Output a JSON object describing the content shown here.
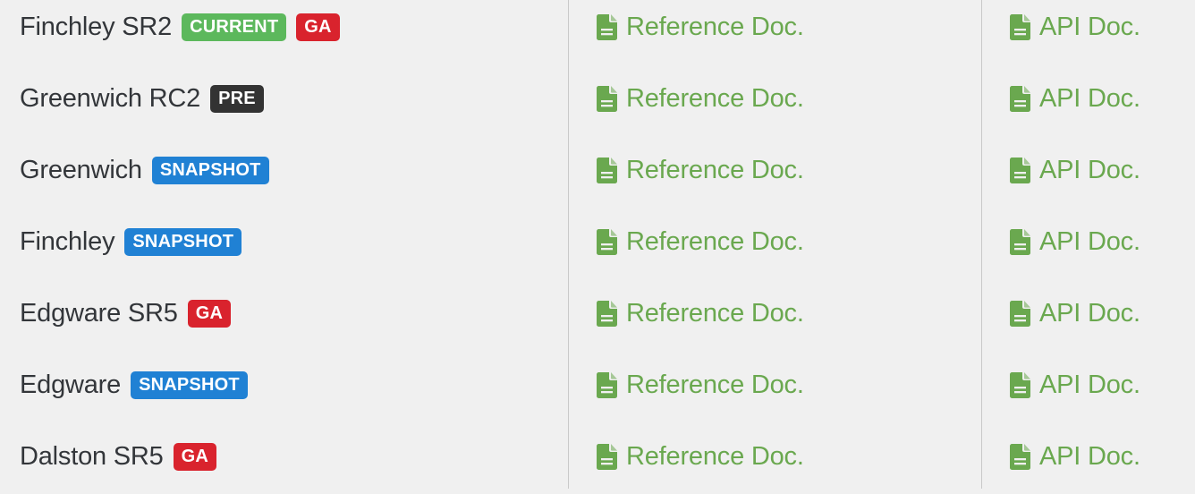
{
  "page": {
    "background_color": "#f0f0f0",
    "divider_color": "#c9c9c9"
  },
  "colors": {
    "version_text": "#33363a",
    "doc_link": "#6aa84f",
    "badge_current": "#5cb85c",
    "badge_ga": "#d9232d",
    "badge_pre": "#333333",
    "badge_snapshot": "#2081d4"
  },
  "icons": {
    "doc": "file-document-icon"
  },
  "rows": [
    {
      "version": "Finchley SR2",
      "badges": [
        {
          "label": "CURRENT",
          "type": "current"
        },
        {
          "label": "GA",
          "type": "ga"
        }
      ],
      "reference_doc": "Reference Doc.",
      "api_doc": "API Doc."
    },
    {
      "version": "Greenwich RC2",
      "badges": [
        {
          "label": "PRE",
          "type": "pre"
        }
      ],
      "reference_doc": "Reference Doc.",
      "api_doc": "API Doc."
    },
    {
      "version": "Greenwich",
      "badges": [
        {
          "label": "SNAPSHOT",
          "type": "snapshot"
        }
      ],
      "reference_doc": "Reference Doc.",
      "api_doc": "API Doc."
    },
    {
      "version": "Finchley",
      "badges": [
        {
          "label": "SNAPSHOT",
          "type": "snapshot"
        }
      ],
      "reference_doc": "Reference Doc.",
      "api_doc": "API Doc."
    },
    {
      "version": "Edgware SR5",
      "badges": [
        {
          "label": "GA",
          "type": "ga"
        }
      ],
      "reference_doc": "Reference Doc.",
      "api_doc": "API Doc."
    },
    {
      "version": "Edgware",
      "badges": [
        {
          "label": "SNAPSHOT",
          "type": "snapshot"
        }
      ],
      "reference_doc": "Reference Doc.",
      "api_doc": "API Doc."
    },
    {
      "version": "Dalston SR5",
      "badges": [
        {
          "label": "GA",
          "type": "ga"
        }
      ],
      "reference_doc": "Reference Doc.",
      "api_doc": "API Doc."
    }
  ]
}
